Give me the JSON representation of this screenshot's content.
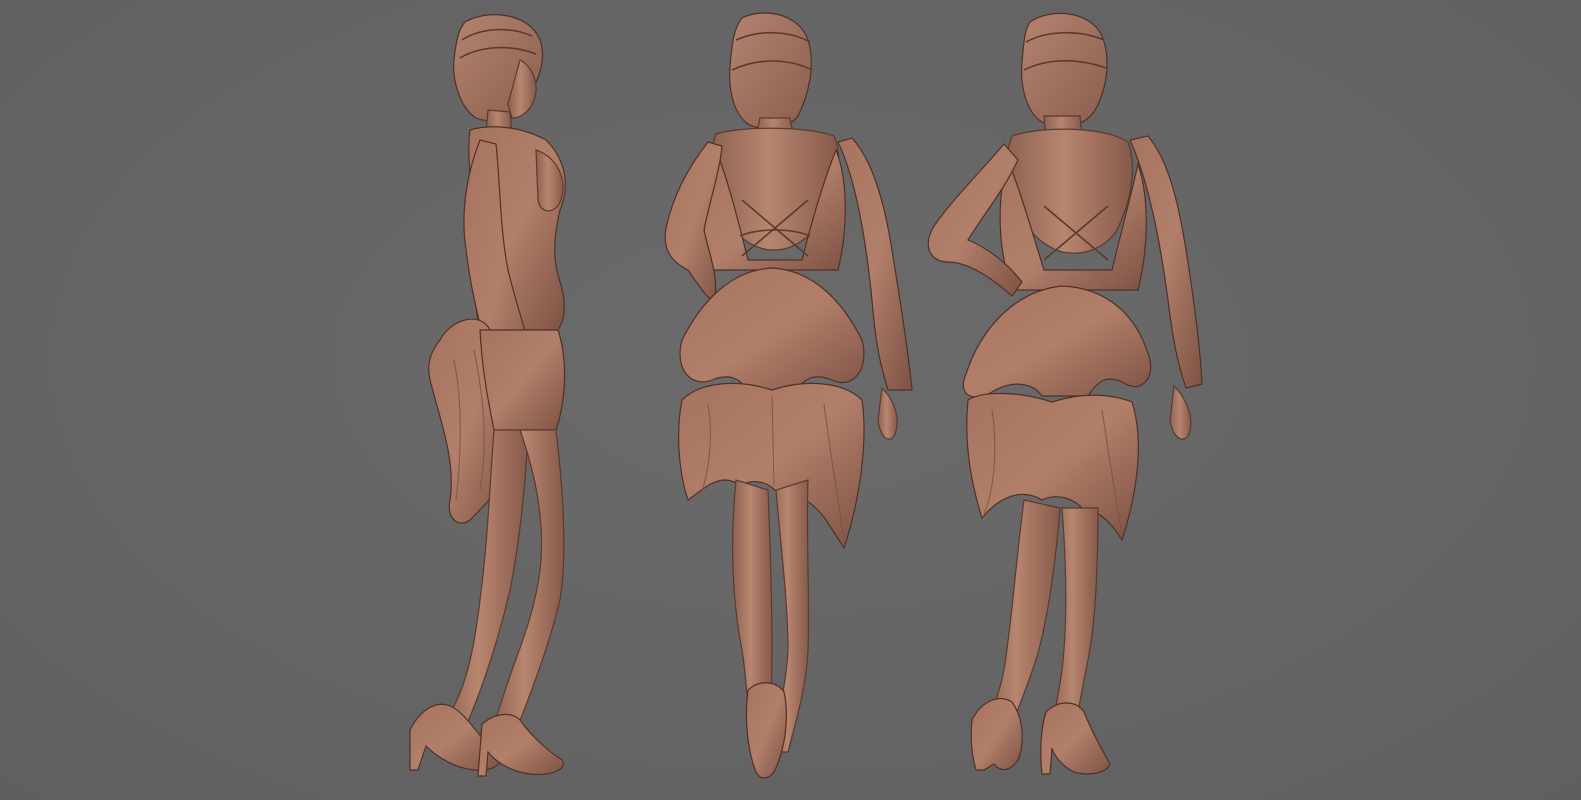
{
  "scene": {
    "background_color": "#646464",
    "clay_color": "#a97866",
    "clay_shadow_color": "#7d5446",
    "figures": [
      {
        "view": "side"
      },
      {
        "view": "back"
      },
      {
        "view": "three-quarter-back"
      }
    ]
  }
}
